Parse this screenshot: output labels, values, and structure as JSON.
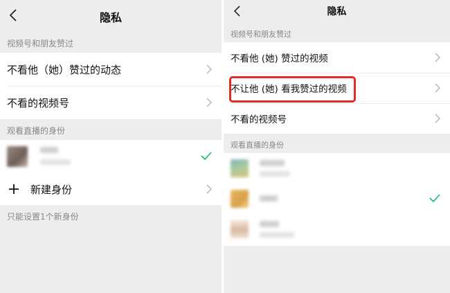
{
  "left": {
    "title": "隐私",
    "section_liked": "视频号和朋友赞过",
    "items": [
      {
        "label": "不看他（她）赞过的动态"
      },
      {
        "label": "不看的视频号"
      }
    ],
    "section_live": "观看直播的身份",
    "add_identity_label": "新建身份",
    "footnote": "只能设置1个新身份"
  },
  "right": {
    "title": "隐私",
    "section_liked": "视频号和朋友赞过",
    "items": [
      {
        "label": "不看他 (她) 赞过的视频"
      },
      {
        "label": "不让他 (她) 看我赞过的视频"
      },
      {
        "label": "不看的视频号"
      }
    ],
    "section_live": "观看直播的身份"
  },
  "icons": {
    "back": "chevron-left-icon",
    "forward": "chevron-right-icon",
    "check": "checkmark-icon",
    "add": "plus-icon"
  },
  "colors": {
    "highlight": "#e02a22",
    "check": "#07c160",
    "background": "#ededed"
  }
}
